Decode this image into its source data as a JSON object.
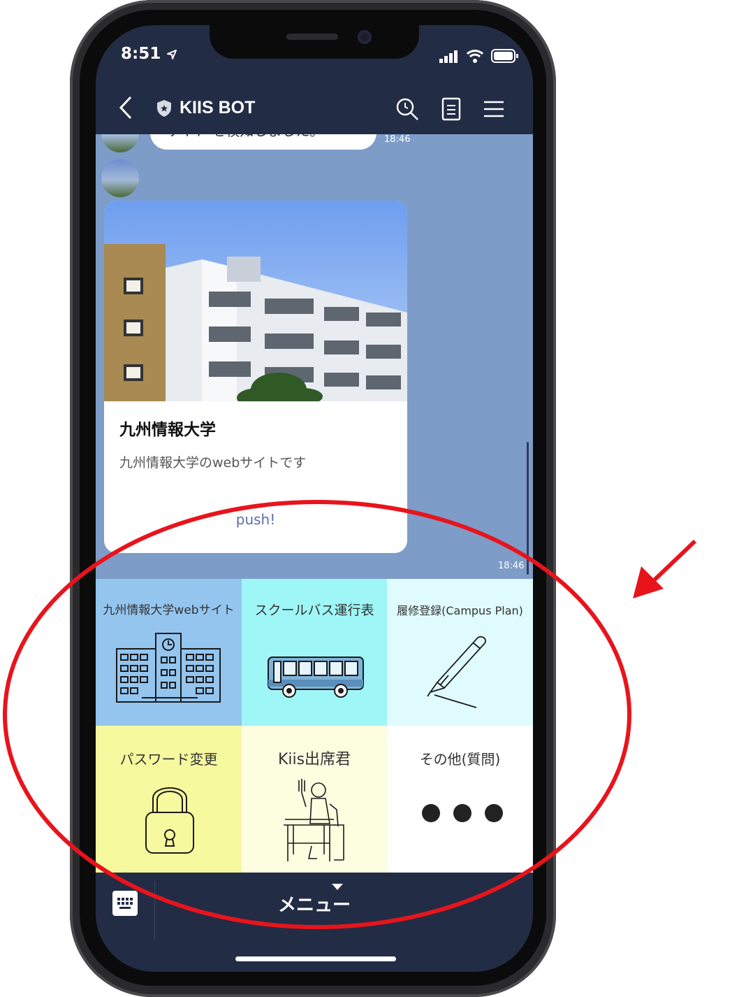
{
  "status": {
    "time": "8:51"
  },
  "header": {
    "title": "KIIS BOT"
  },
  "chat": {
    "prev_message": "サイト を検知しました。",
    "prev_time": "18:46",
    "card": {
      "title": "九州情報大学",
      "description": "九州情報大学のwebサイトです",
      "link": "push!"
    },
    "card_time": "18:46"
  },
  "menu": {
    "items": [
      {
        "label": "九州情報大学webサイト",
        "icon": "school-building-icon",
        "bg": "#93c5ef"
      },
      {
        "label": "スクールバス運行表",
        "icon": "bus-icon",
        "bg": "#9ff6f6"
      },
      {
        "label": "履修登録(Campus Plan)",
        "icon": "pencil-icon",
        "bg": "#e0fbfd"
      },
      {
        "label": "パスワード変更",
        "icon": "padlock-icon",
        "bg": "#f6f99d"
      },
      {
        "label": "Kiis出席君",
        "icon": "student-desk-icon",
        "bg": "#fdfde0"
      },
      {
        "label": "その他(質問)",
        "icon": "more-dots-icon",
        "bg": "#ffffff"
      }
    ]
  },
  "bottom": {
    "menu_label": "メニュー"
  },
  "colors": {
    "header": "#222c45",
    "chat_bg": "#7e9cc8",
    "annotation": "#e8141c"
  }
}
